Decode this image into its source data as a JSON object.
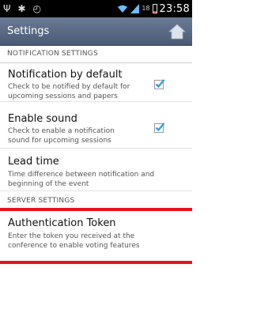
{
  "status_bar": {
    "icons": [
      "usb-icon",
      "android-debug-icon",
      "alarm-icon"
    ],
    "battery_level": "18",
    "time": "23:58"
  },
  "action_bar": {
    "title": "Settings",
    "home_icon": "home-icon"
  },
  "sections": {
    "notification": "NOTIFICATION SETTINGS",
    "server": "SERVER SETTINGS"
  },
  "prefs": {
    "notify_default": {
      "title": "Notification by default",
      "summary_line1": "Check to be notified by default for",
      "summary_line2": "upcoming sessions and papers",
      "checked": true
    },
    "enable_sound": {
      "title": "Enable sound",
      "summary_line1": "Check to enable a notification",
      "summary_line2": "sound for upcoming sessions",
      "checked": true
    },
    "lead_time": {
      "title": "Lead time",
      "summary_line1": "Time difference between notification and",
      "summary_line2": "beginning of the event"
    },
    "auth_token": {
      "title": "Authentication Token",
      "summary_line1": "Enter the token you received at the",
      "summary_line2": "conference to enable voting features"
    }
  },
  "colors": {
    "action_bar": "#5a6a84",
    "checkmark": "#3aa0d8",
    "highlight": "#e8121b"
  }
}
